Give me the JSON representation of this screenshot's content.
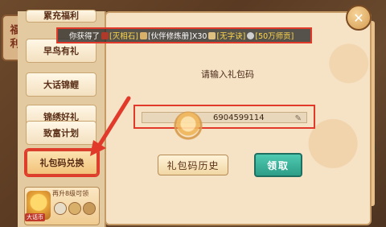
{
  "sidebar": {
    "tab_label": "福利",
    "items": [
      {
        "label": "累充福利"
      },
      {
        "label": "早鸟有礼"
      },
      {
        "label": "大话锦鲤"
      },
      {
        "label": "锦绣好礼"
      },
      {
        "label": "致富计划"
      },
      {
        "label": "礼包码兑换"
      }
    ],
    "promo": {
      "text": "再升8级可领",
      "badge": "大话币"
    }
  },
  "toast": {
    "prefix": "你获得了",
    "items": [
      {
        "text": "[灭相石]",
        "color": "#ffd84a",
        "icon_color": "#b03a2a"
      },
      {
        "text": "[伙伴修炼册]X30",
        "color": "#ffffff",
        "icon_color": "#d8b06a"
      },
      {
        "text": "[无字诀]",
        "color": "#ffd84a",
        "icon_color": "#e0c080"
      },
      {
        "text": "[50万师贡]",
        "color": "#ffd84a",
        "icon_color": "#cfcfcf"
      }
    ]
  },
  "panel": {
    "prompt": "请输入礼包码",
    "code_input": {
      "value": "6904599114"
    },
    "history_button": "礼包码历史",
    "claim_button": "领取"
  },
  "icons": {
    "close": "close-icon",
    "pencil": "pencil-icon"
  },
  "colors": {
    "highlight_red": "#e23a2a",
    "claim_green": "#2e9d88"
  }
}
